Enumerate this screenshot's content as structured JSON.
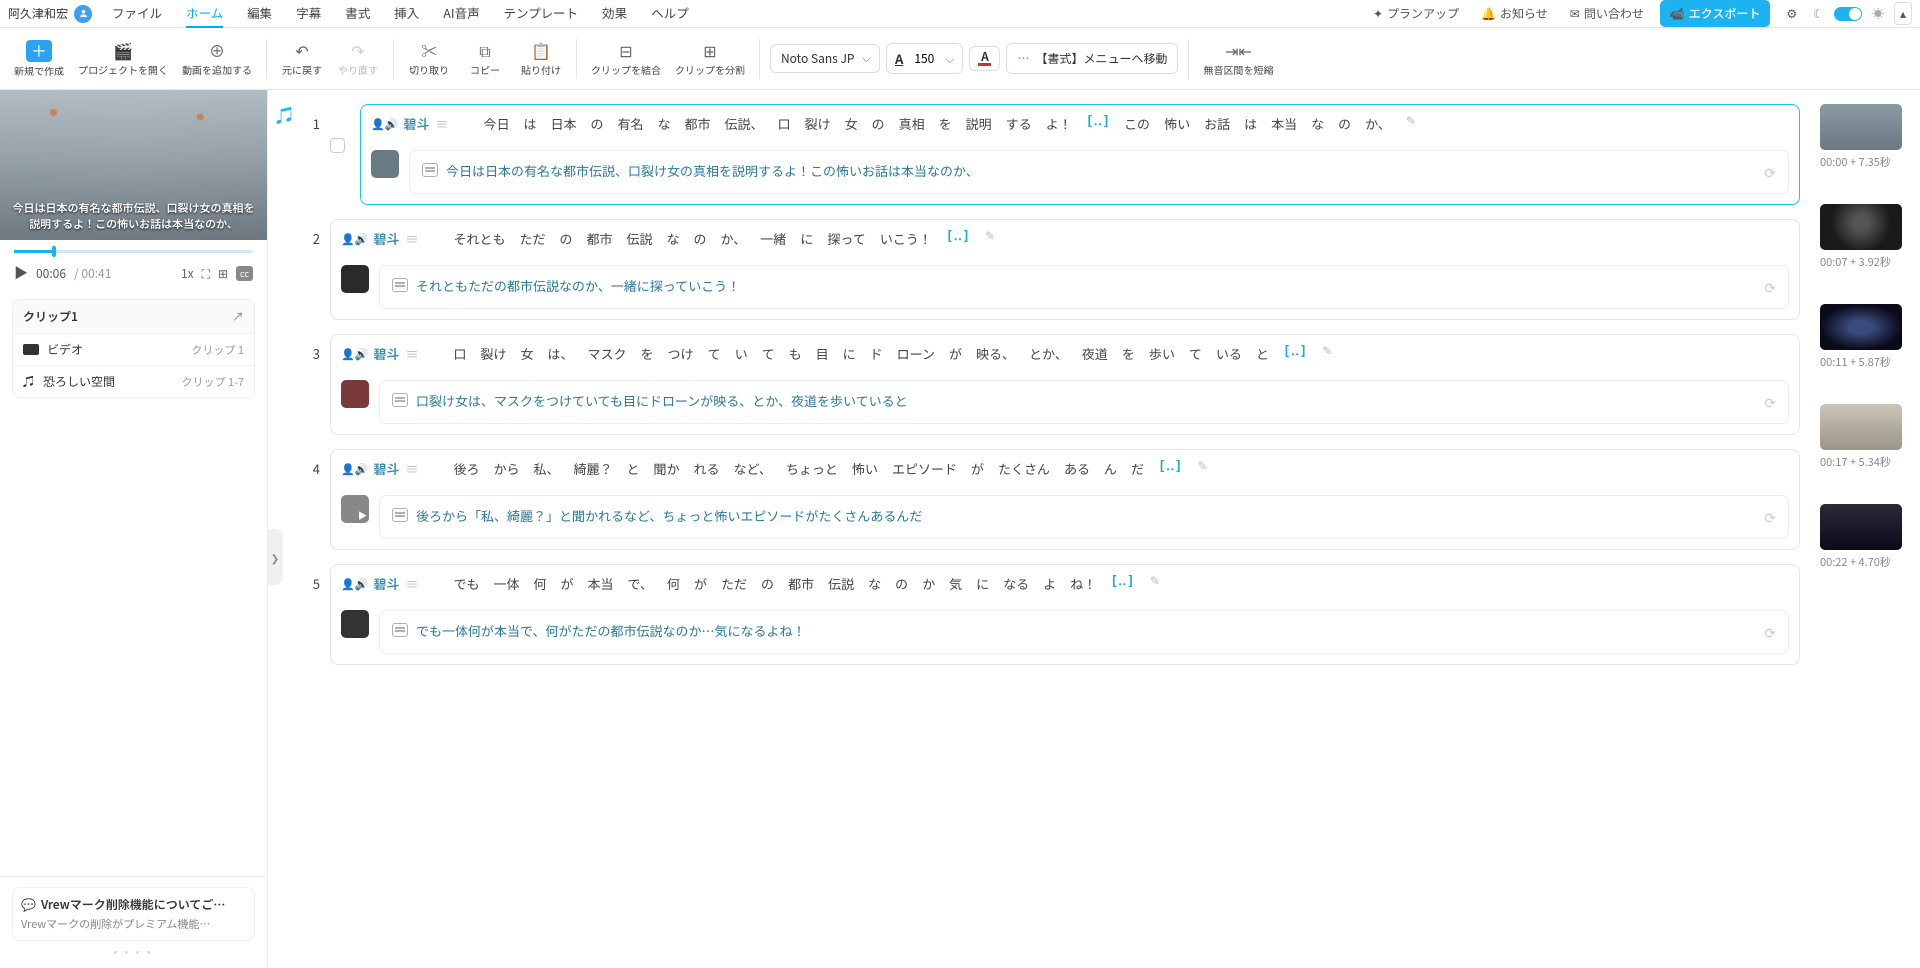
{
  "user": {
    "name": "阿久津和宏"
  },
  "menu": {
    "file": "ファイル",
    "home": "ホーム",
    "edit": "編集",
    "subtitle": "字幕",
    "style": "書式",
    "insert": "挿入",
    "aivox": "AI音声",
    "template": "テンプレート",
    "effect": "効果",
    "help": "ヘルプ"
  },
  "right_menu": {
    "plan": "プランアップ",
    "notice": "お知らせ",
    "contact": "問い合わせ",
    "export": "エクスポート"
  },
  "toolbar": {
    "new": "新規で作成",
    "openproj": "プロジェクトを開く",
    "addvideo": "動画を追加する",
    "undo": "元に戻す",
    "redo": "やり直す",
    "cut": "切り取り",
    "copy": "コピー",
    "paste": "貼り付け",
    "merge": "クリップを結合",
    "split": "クリップを分割",
    "font": "Noto Sans JP",
    "size": "150",
    "fmt_jump": "【書式】メニューへ移動",
    "shrink": "無音区間を短縮"
  },
  "preview": {
    "subtitle": "今日は日本の有名な都市伝説、口裂け女の真相を説明するよ！この怖いお話は本当なのか、",
    "ct": "00:06",
    "dur": "/ 00:41",
    "speed": "1x"
  },
  "clip_panel": {
    "title": "クリップ1",
    "video": "ビデオ",
    "video_meta": "クリップ 1",
    "bgm": "恐ろしい空間",
    "bgm_meta": "クリップ 1-7"
  },
  "notice_box": {
    "title": "Vrewマーク削除機能についてご…",
    "desc": "Vrewマークの削除がプレミアム機能…"
  },
  "clips": [
    {
      "n": "1",
      "speaker": "碧斗",
      "selected": true,
      "tokens": [
        "今日",
        "は",
        "日本",
        "の",
        "有名",
        "な",
        "都市",
        "伝説、",
        "口",
        "裂け",
        "女",
        "の",
        "真相",
        "を",
        "説明",
        "する",
        "よ！",
        "[‥]",
        "この",
        "怖い",
        "お話",
        "は",
        "本当",
        "な",
        "の",
        "か、"
      ],
      "sub": "今日は日本の有名な都市伝説、口裂け女の真相を説明するよ！この怖いお話は本当なのか、",
      "thumb_class": "t1",
      "time": "00:00 + 7.35秒",
      "rimg": "i1"
    },
    {
      "n": "2",
      "speaker": "碧斗",
      "tokens": [
        "それとも",
        "ただ",
        "の",
        "都市",
        "伝説",
        "な",
        "の",
        "か、",
        "一緒",
        "に",
        "探って",
        "いこう！",
        "[‥]"
      ],
      "sub": "それともただの都市伝説なのか、一緒に探っていこう！",
      "thumb_class": "t2",
      "time": "00:07 + 3.92秒",
      "rimg": "i2"
    },
    {
      "n": "3",
      "speaker": "碧斗",
      "tokens": [
        "口",
        "裂け",
        "女",
        "は、",
        "マスク",
        "を",
        "つけ",
        "て",
        "い",
        "て",
        "も",
        "目",
        "に",
        "ド",
        "ローン",
        "が",
        "映る、",
        "とか、",
        "夜道",
        "を",
        "歩い",
        "て",
        "いる",
        "と",
        "[‥]"
      ],
      "sub": "口裂け女は、マスクをつけていても目にドローンが映る、とか、夜道を歩いていると",
      "thumb_class": "t3",
      "time": "00:11 + 5.87秒",
      "rimg": "i3"
    },
    {
      "n": "4",
      "speaker": "碧斗",
      "tokens": [
        "後ろ",
        "から",
        "私、",
        "綺麗？",
        "と",
        "聞か",
        "れる",
        "など、",
        "ちょっと",
        "怖い",
        "エピソード",
        "が",
        "たくさん",
        "ある",
        "ん",
        "だ",
        "[‥]"
      ],
      "sub": "後ろから「私、綺麗？」と聞かれるなど、ちょっと怖いエピソードがたくさんあるんだ",
      "thumb_class": "t4",
      "time": "00:17 + 5.34秒",
      "rimg": "i4"
    },
    {
      "n": "5",
      "speaker": "碧斗",
      "tokens": [
        "でも",
        "一体",
        "何",
        "が",
        "本当",
        "で、",
        "何",
        "が",
        "ただ",
        "の",
        "都市",
        "伝説",
        "な",
        "の",
        "か",
        "気",
        "に",
        "なる",
        "よ",
        "ね！",
        "[‥]"
      ],
      "sub": "でも一体何が本当で、何がただの都市伝説なのか…気になるよね！",
      "thumb_class": "t5",
      "time": "00:22 + 4.70秒",
      "rimg": "i5"
    }
  ]
}
